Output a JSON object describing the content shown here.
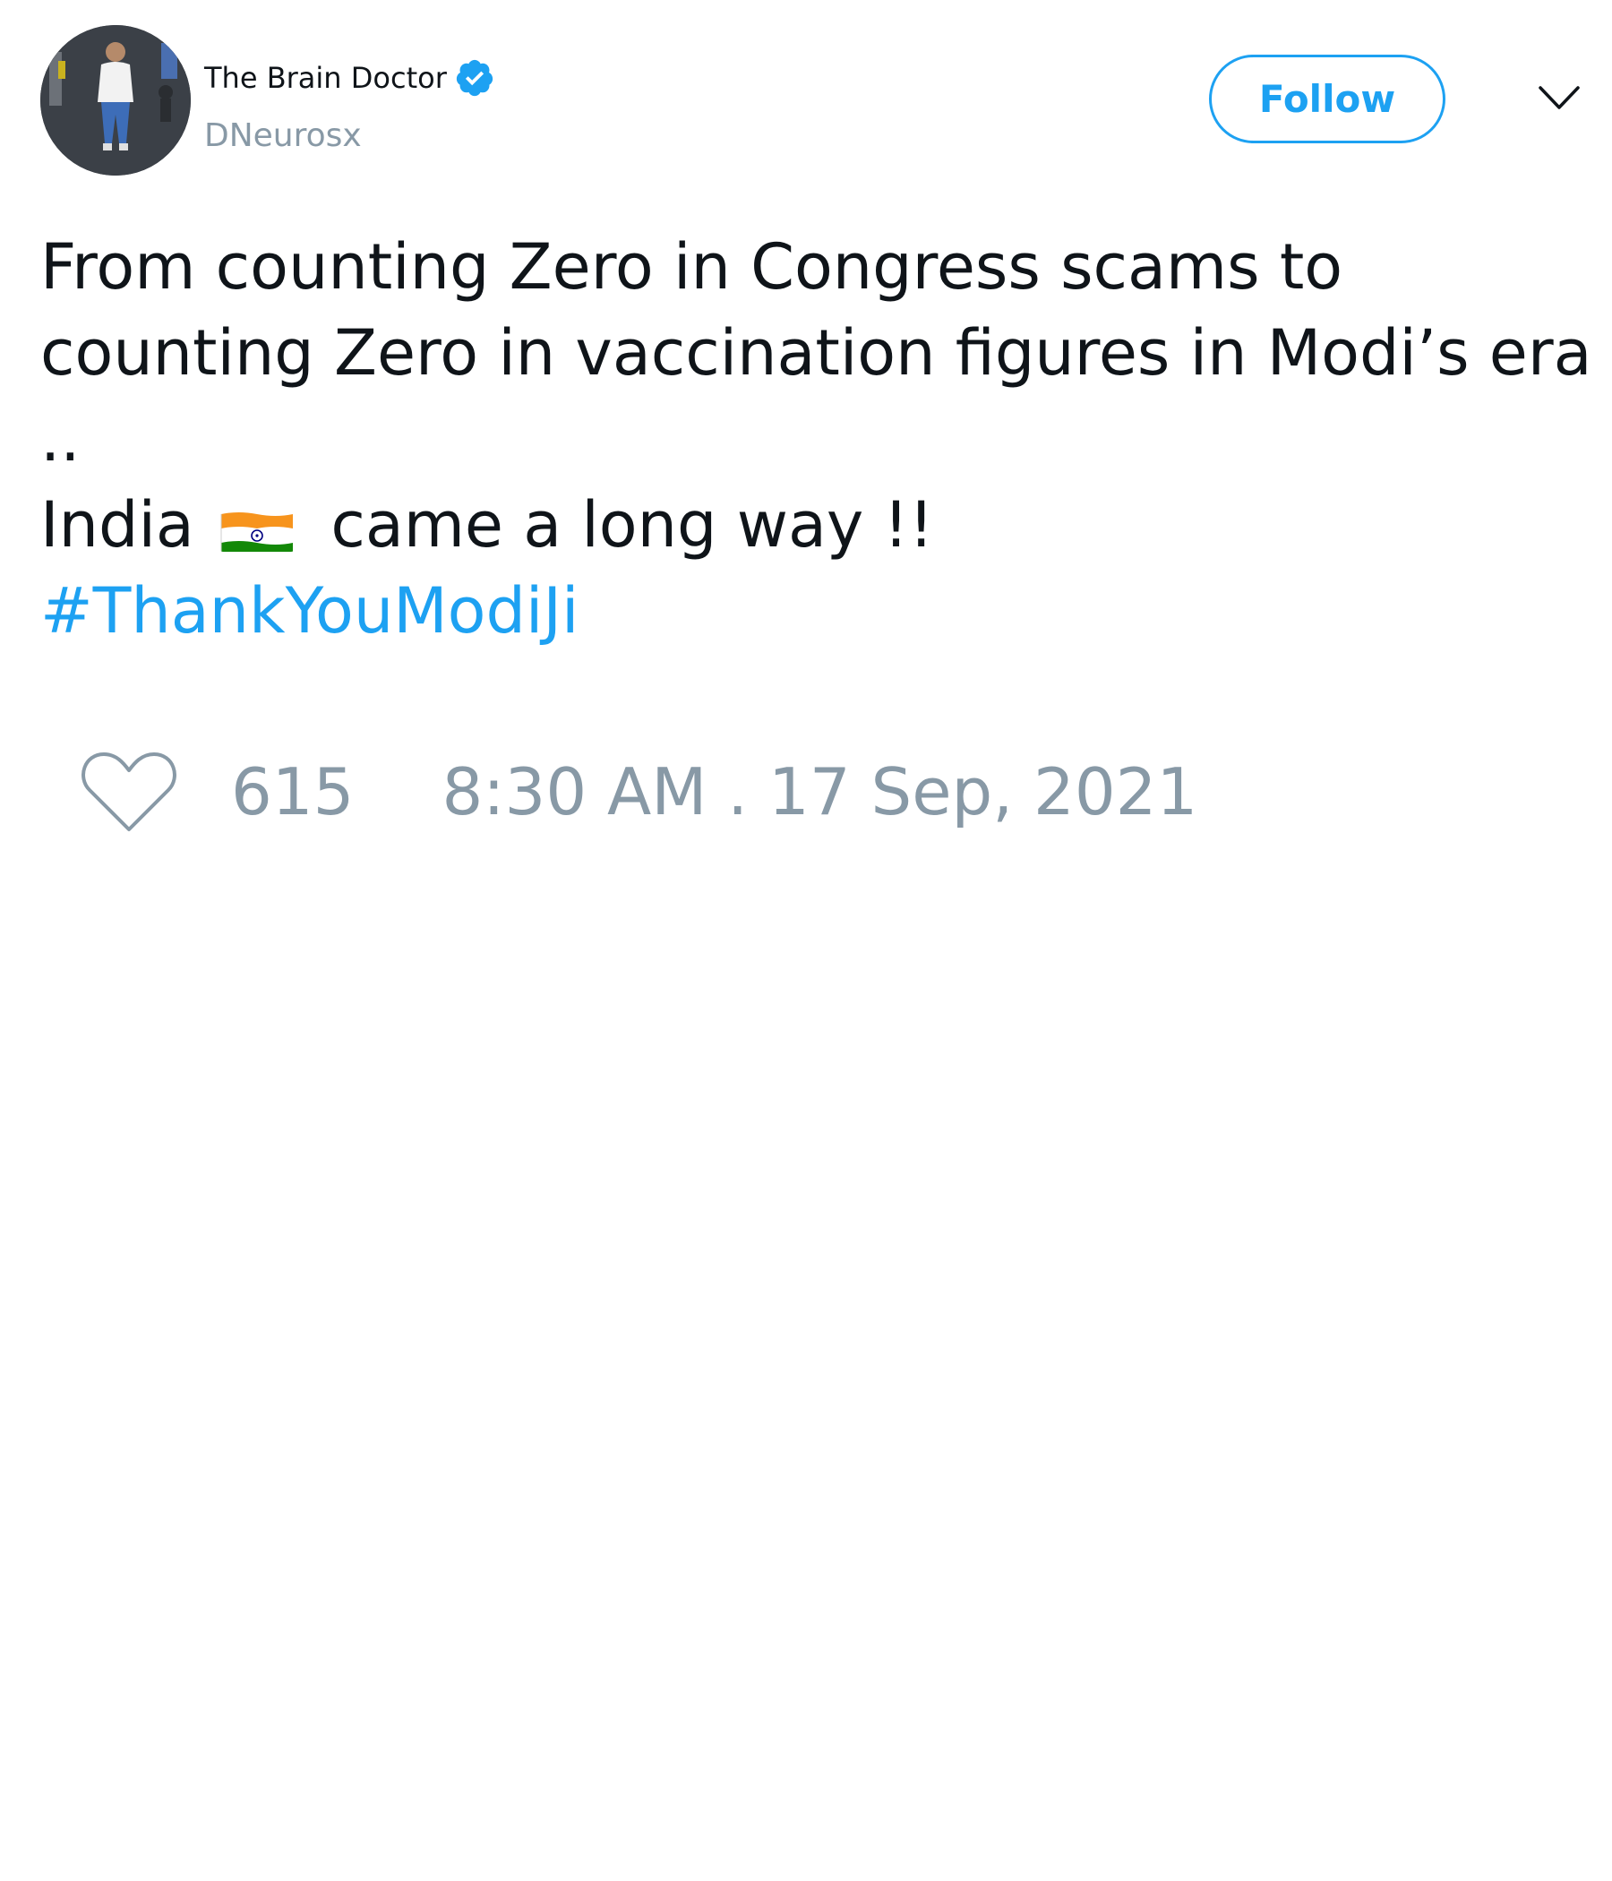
{
  "author": {
    "display_name": "The Brain Doctor",
    "handle": "DNeurosx",
    "verified": true
  },
  "actions": {
    "follow_label": "Follow"
  },
  "tweet": {
    "lines": [
      "From counting Zero in Congress scams to",
      "counting Zero in vaccination figures in Modi’s era",
      ".."
    ],
    "line4_prefix": "India",
    "line4_suffix": "came a long way !!",
    "hashtag": "#ThankYouModiJi"
  },
  "stats": {
    "likes": "615",
    "timestamp": "8:30 AM . 17 Sep, 2021"
  },
  "colors": {
    "accent": "#1da1f2",
    "muted": "#8899a6",
    "text": "#0f1419"
  },
  "icons": {
    "verified": "verified-badge-icon",
    "more": "chevron-down-icon",
    "like": "heart-icon",
    "flag": "india-flag-emoji"
  }
}
